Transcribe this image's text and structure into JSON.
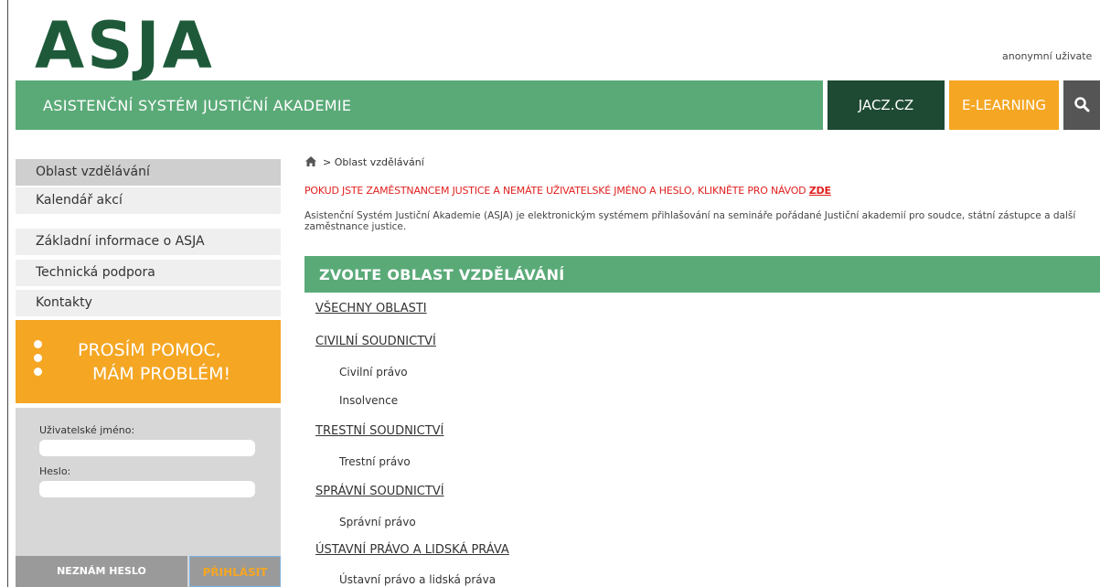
{
  "header": {
    "logo": "ASJA",
    "user_info": "anonymní uživate",
    "banner_title": "ASISTENČNÍ SYSTÉM JUSTIČNÍ AKADEMIE",
    "jacz_label": "JACZ.CZ",
    "elearning_label": "E-LEARNING",
    "search_icon": "search-icon"
  },
  "sidebar": {
    "items": [
      {
        "label": "Oblast vzdělávání",
        "active": true
      },
      {
        "label": "Kalendář akcí"
      },
      {
        "label": "Základní informace o ASJA"
      },
      {
        "label": "Technická podpora"
      },
      {
        "label": "Kontakty"
      }
    ],
    "help_line1": "PROSÍM POMOC,",
    "help_line2": "MÁM PROBLÉM!",
    "login": {
      "username_label": "Uživatelské jméno:",
      "username_value": "",
      "password_label": "Heslo:",
      "password_value": "",
      "forgot_label": "NEZNÁM HESLO",
      "login_label": "PŘIHLÁSIT"
    }
  },
  "main": {
    "breadcrumb": "> Oblast vzdělávání",
    "notice_text": "POKUD JSTE ZAMĚSTNANCEM JUSTICE A NEMÁTE UŽIVATELSKÉ JMÉNO A HESLO, KLIKNĚTE PRO NÁVOD ",
    "notice_link": "ZDE",
    "intro": "Asistenční Systém Justiční Akademie (ASJA) je elektronickým systémem přihlašování na semináře pořádané Justiční akademií pro soudce, státní zástupce a další zaměstnance justice.",
    "section_title": "ZVOLTE OBLAST VZDĚLÁVÁNÍ",
    "categories": [
      {
        "label": "VŠECHNY OBLASTI",
        "subs": []
      },
      {
        "label": "CIVILNÍ SOUDNICTVÍ",
        "subs": [
          "Civilní právo",
          "Insolvence"
        ]
      },
      {
        "label": "TRESTNÍ SOUDNICTVÍ",
        "subs": [
          "Trestní právo"
        ]
      },
      {
        "label": "SPRÁVNÍ SOUDNICTVÍ",
        "subs": [
          "Správní právo"
        ]
      },
      {
        "label": "ÚSTAVNÍ PRÁVO A LIDSKÁ PRÁVA",
        "subs": [
          "Ústavní právo a lidská práva"
        ]
      }
    ]
  },
  "colors": {
    "brand_green": "#5aaa78",
    "dark_green": "#1e4a33",
    "orange": "#f5a623",
    "alert_red": "#e0201f"
  }
}
